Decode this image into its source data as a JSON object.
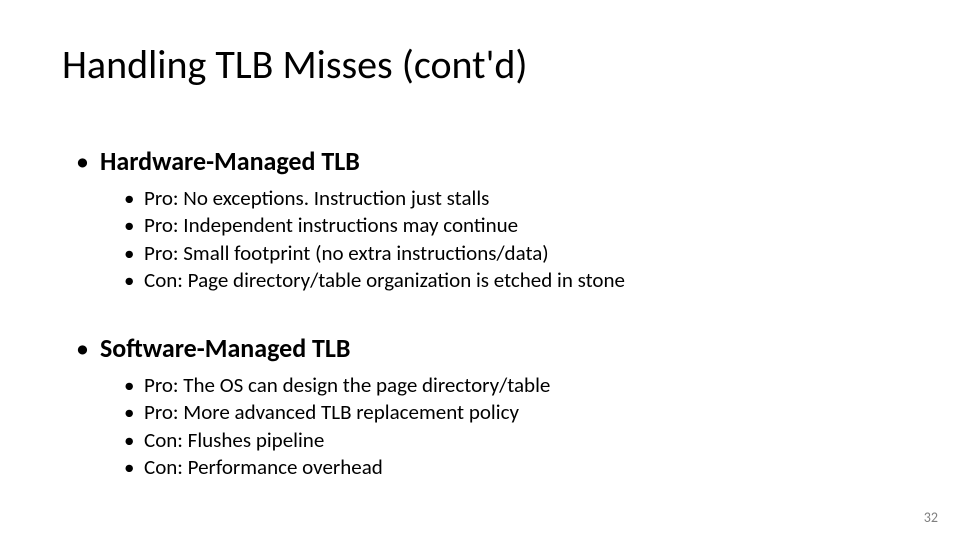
{
  "title": "Handling TLB Misses (cont'd)",
  "sections": [
    {
      "heading": "Hardware-Managed TLB",
      "items": [
        "Pro: No exceptions. Instruction just stalls",
        "Pro: Independent instructions may continue",
        "Pro: Small footprint (no extra instructions/data)",
        "Con: Page directory/table organization is etched in stone"
      ]
    },
    {
      "heading": "Software-Managed TLB",
      "items": [
        "Pro: The OS can design the page directory/table",
        "Pro: More advanced TLB replacement policy",
        "Con: Flushes pipeline",
        "Con: Performance overhead"
      ]
    }
  ],
  "page_number": "32"
}
